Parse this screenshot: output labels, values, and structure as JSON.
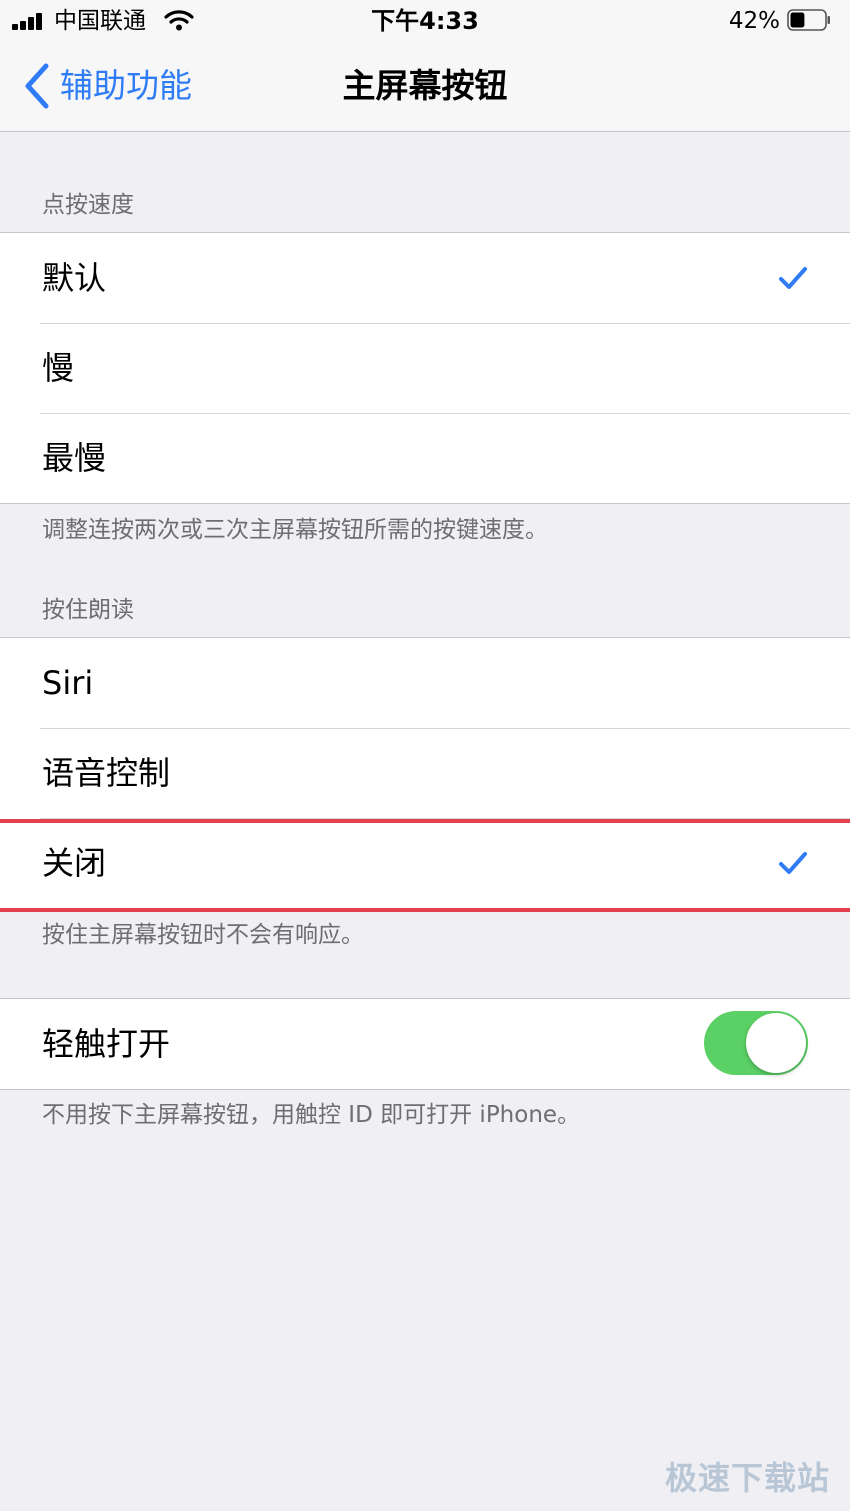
{
  "status_bar": {
    "carrier": "中国联通",
    "time": "下午4:33",
    "battery": "42%",
    "battery_level": 0.42
  },
  "nav": {
    "back_label": "辅助功能",
    "title": "主屏幕按钮"
  },
  "click_speed": {
    "header": "点按速度",
    "options": [
      {
        "label": "默认",
        "selected": true
      },
      {
        "label": "慢",
        "selected": false
      },
      {
        "label": "最慢",
        "selected": false
      }
    ],
    "footer": "调整连按两次或三次主屏幕按钮所需的按键速度。"
  },
  "press_and_hold": {
    "header": "按住朗读",
    "options": [
      {
        "label": "Siri",
        "selected": false
      },
      {
        "label": "语音控制",
        "selected": false
      },
      {
        "label": "关闭",
        "selected": true
      }
    ],
    "footer": "按住主屏幕按钮时不会有响应。"
  },
  "rest_finger": {
    "label": "轻触打开",
    "enabled": true,
    "footer": "不用按下主屏幕按钮，用触控 ID 即可打开 iPhone。"
  },
  "colors": {
    "accent": "#2f7cf6",
    "toggle_on": "#5bd064",
    "highlight": "#e2404c"
  },
  "watermark": "极速下载站"
}
